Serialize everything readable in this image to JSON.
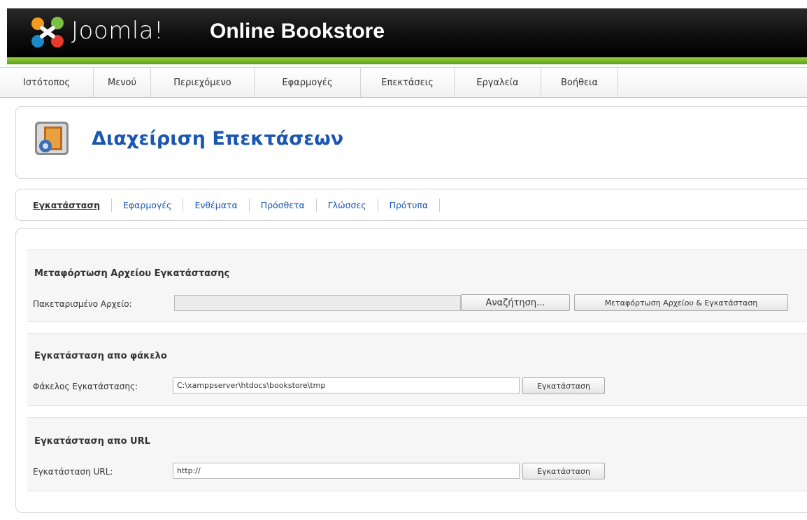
{
  "header": {
    "brand": "Joomla!",
    "site_title": "Online Bookstore"
  },
  "menu": {
    "items": [
      {
        "label": "Ιστότοπος"
      },
      {
        "label": "Μενού"
      },
      {
        "label": "Περιεχόμενο"
      },
      {
        "label": "Εφαρμογές"
      },
      {
        "label": "Επεκτάσεις"
      },
      {
        "label": "Εργαλεία"
      },
      {
        "label": "Βοήθεια"
      }
    ]
  },
  "page": {
    "title": "Διαχείριση Επεκτάσεων",
    "icon": "extension-manager-icon"
  },
  "submenu": {
    "items": [
      {
        "label": "Εγκατάσταση",
        "active": true
      },
      {
        "label": "Εφαρμογές"
      },
      {
        "label": "Ενθέματα"
      },
      {
        "label": "Πρόσθετα"
      },
      {
        "label": "Γλώσσες"
      },
      {
        "label": "Πρότυπα"
      }
    ]
  },
  "upload": {
    "title": "Μεταφόρτωση Αρχείου Εγκατάστασης",
    "label": "Πακεταρισμένο Αρχείο:",
    "file_value": "",
    "browse_label": "Αναζήτηση...",
    "submit_label": "Μεταφόρτωση Αρχείου & Εγκατάσταση"
  },
  "folder": {
    "title": "Εγκατάσταση απο φάκελο",
    "label": "Φάκελος Εγκατάστασης:",
    "value": "C:\\xamppserver\\htdocs\\bookstore\\tmp",
    "submit_label": "Εγκατάσταση"
  },
  "url": {
    "title": "Εγκατάσταση απο URL",
    "label": "Εγκατάσταση URL:",
    "value": "http://",
    "submit_label": "Εγκατάσταση"
  },
  "colors": {
    "header_black": "#000000",
    "header_green": "#7bbf2c",
    "link_blue": "#1b57b1"
  }
}
